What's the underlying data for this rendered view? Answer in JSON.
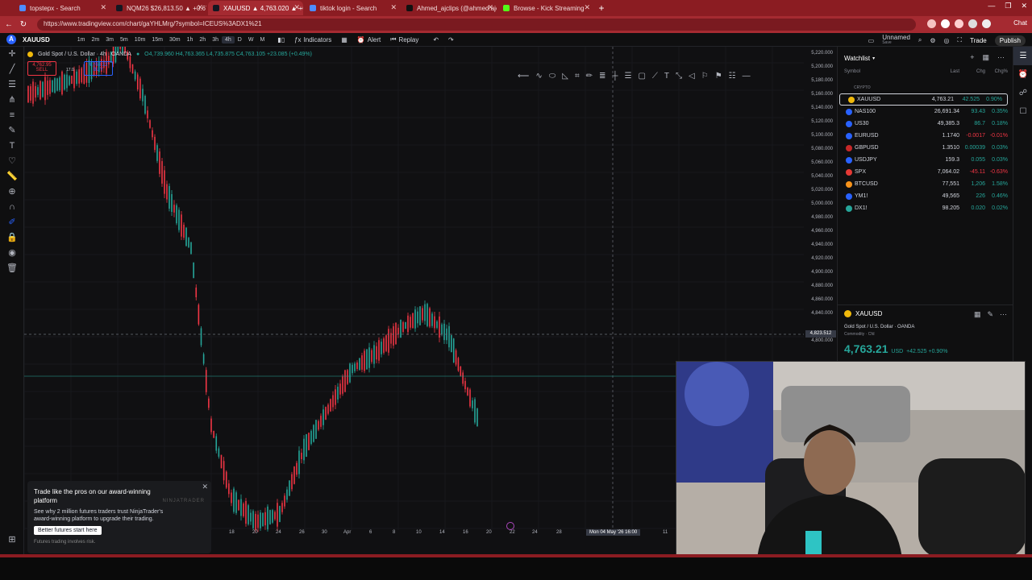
{
  "browser": {
    "tabs": [
      {
        "label": "topstepx - Search",
        "color": "#4e8cff"
      },
      {
        "label": "NQM26 $26,813.50 ▲ +0.67%",
        "color": "#131722"
      },
      {
        "label": "XAUUSD ▲ 4,763.020 ▲ +0.9% Unn...",
        "color": "#131722"
      },
      {
        "label": "tiktok login - Search",
        "color": "#4e8cff"
      },
      {
        "label": "Ahmed_ajclips (@ahmed.ajclips1)",
        "color": "#111111"
      },
      {
        "label": "Browse - Kick Streaming",
        "color": "#53fc18"
      }
    ],
    "url": "https://www.tradingview.com/chart/gaYHLMrg/?symbol=ICEUS%3ADX1%21",
    "chat_label": "Chat"
  },
  "toolbar": {
    "symbol": "XAUUSD",
    "timeframes": [
      "1m",
      "2m",
      "3m",
      "5m",
      "10m",
      "15m",
      "30m",
      "1h",
      "2h",
      "3h",
      "4h",
      "D",
      "W",
      "M"
    ],
    "active_timeframe": "4h",
    "indicators_label": "Indicators",
    "alert_label": "Alert",
    "replay_label": "Replay",
    "layout_name": "Unnamed",
    "layout_sub": "Save",
    "trade_label": "Trade",
    "publish_label": "Publish"
  },
  "chart": {
    "title": "Gold Spot / U.S. Dollar · 4h · OANDA",
    "ohlc": "O4,739.960 H4,763.365 L4,735.875 C4,763.105 +23.085 (+0.49%)",
    "sell_price": "4,762.95",
    "sell_label": "SELL",
    "spread": "17.0",
    "buy_price": "4,763.12",
    "buy_label": "BUY",
    "price_ticks": [
      "5,220.000",
      "5,200.000",
      "5,180.000",
      "5,160.000",
      "5,140.000",
      "5,120.000",
      "5,100.000",
      "5,080.000",
      "5,060.000",
      "5,040.000",
      "5,020.000",
      "5,000.000",
      "4,980.000",
      "4,960.000",
      "4,940.000",
      "4,920.000",
      "4,900.000",
      "4,880.000",
      "4,860.000",
      "4,840.000",
      "4,823.512",
      "4,800.000"
    ],
    "crosshair_price": "4,823.512",
    "time_ticks": [
      "18",
      "20",
      "24",
      "26",
      "30",
      "Apr",
      "6",
      "8",
      "10",
      "14",
      "16",
      "20",
      "22",
      "24",
      "28",
      "11"
    ],
    "crosshair_time": "Mon 04 May '26  16:00"
  },
  "ad": {
    "title": "Trade like the pros on our award-winning platform",
    "brand": "NINJATRADER",
    "body": "See why 2 million futures traders trust NinjaTrader's award-winning platform to upgrade their trading.",
    "cta": "Better futures start here",
    "note": "Futures trading involves risk."
  },
  "watchlist": {
    "title": "Watchlist",
    "columns": {
      "symbol": "Symbol",
      "last": "Last",
      "chg": "Chg",
      "chgp": "Chg%"
    },
    "group": "CRYPTO",
    "rows": [
      {
        "symbol": "XAUUSD",
        "last": "4,763.21",
        "chg": "42.525",
        "chgp": "0.90%",
        "dir": "up",
        "icon": "#f0b90b"
      },
      {
        "symbol": "NAS100",
        "last": "26,691.34",
        "chg": "93.43",
        "chgp": "0.35%",
        "dir": "up",
        "icon": "#2962ff"
      },
      {
        "symbol": "US30",
        "last": "49,385.3",
        "chg": "86.7",
        "chgp": "0.18%",
        "dir": "up",
        "icon": "#2962ff"
      },
      {
        "symbol": "EURUSD",
        "last": "1.1740",
        "chg": "-0.0017",
        "chgp": "-0.01%",
        "dir": "down",
        "icon": "#2962ff"
      },
      {
        "symbol": "GBPUSD",
        "last": "1.3510",
        "chg": "0.00039",
        "chgp": "0.03%",
        "dir": "up",
        "icon": "#c62828"
      },
      {
        "symbol": "USDJPY",
        "last": "159.3",
        "chg": "0.055",
        "chgp": "0.03%",
        "dir": "up",
        "icon": "#2962ff"
      },
      {
        "symbol": "SPX",
        "last": "7,064.02",
        "chg": "-45.11",
        "chgp": "-0.63%",
        "dir": "down",
        "icon": "#e53935"
      },
      {
        "symbol": "BTCUSD",
        "last": "77,551",
        "chg": "1,206",
        "chgp": "1.58%",
        "dir": "up",
        "icon": "#f7931a"
      },
      {
        "symbol": "YM1!",
        "last": "49,565",
        "chg": "226",
        "chgp": "0.46%",
        "dir": "up",
        "icon": "#2962ff"
      },
      {
        "symbol": "DX1!",
        "last": "98.205",
        "chg": "0.020",
        "chgp": "0.02%",
        "dir": "up",
        "icon": "#26a69a"
      }
    ]
  },
  "details": {
    "symbol": "XAUUSD",
    "description": "Gold Spot / U.S. Dollar · OANDA",
    "type": "Commodity · Cfd",
    "price": "4,763.21",
    "currency": "USD",
    "change": "+42.525  +0.90%"
  },
  "colors": {
    "up": "#26a69a",
    "down": "#f23645",
    "accent": "#2962ff",
    "chrome": "#a52a31"
  }
}
